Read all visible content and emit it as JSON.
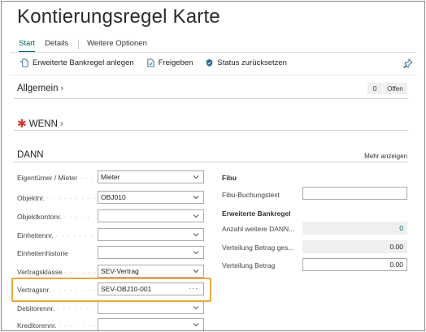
{
  "page": {
    "title": "Kontierungsregel Karte"
  },
  "tabs": [
    {
      "label": "Start",
      "active": true
    },
    {
      "label": "Details",
      "active": false
    },
    {
      "label": "Weitere Optionen",
      "active": false
    }
  ],
  "actions": {
    "create_bank_rule": "Erweiterte Bankregel anlegen",
    "release": "Freigeben",
    "reset_status": "Status zurücksetzen"
  },
  "sections": {
    "allgemein": {
      "title": "Allgemein",
      "count": "0",
      "status": "Offen"
    },
    "wenn": {
      "title": "WENN"
    },
    "dann": {
      "title": "DANN",
      "show_more": "Mehr anzeigen"
    }
  },
  "left_fields": [
    {
      "label": "Eigentümer / Mieter",
      "value": "Mieter",
      "control": "select"
    },
    {
      "label": "Objektnr.",
      "value": "OBJ010",
      "control": "select"
    },
    {
      "label": "Objektkontonr.",
      "value": "",
      "control": "select"
    },
    {
      "label": "Einheitennr.",
      "value": "",
      "control": "select"
    },
    {
      "label": "Einheitenhistorie",
      "value": "",
      "control": "select"
    },
    {
      "label": "Vertragsklasse",
      "value": "SEV-Vertrag",
      "control": "select"
    },
    {
      "label": "Vertragsnr.",
      "value": "SEV-OBJ10-001",
      "control": "lookup"
    },
    {
      "label": "Debitorennr.",
      "value": "",
      "control": "select"
    },
    {
      "label": "Kreditorennr.",
      "value": "",
      "control": "select"
    }
  ],
  "right": {
    "fibu_heading": "Fibu",
    "fibu_posting_text_label": "Fibu-Buchungstext",
    "fibu_posting_text_value": "",
    "bank_rule_heading": "Erweiterte Bankregel",
    "count_more_label": "Anzahl weitere DANN...",
    "count_more_value": "0",
    "dist_amount_remaining_label": "Verteilung Betrag ges...",
    "dist_amount_remaining_value": "0.00",
    "dist_amount_label": "Verteilung Betrag",
    "dist_amount_value": "0.00"
  },
  "colors": {
    "accent": "#00625f",
    "highlight": "#e8a93a",
    "required": "#d33a2f"
  },
  "icons": [
    "new-document-icon",
    "release-icon",
    "reset-status-icon",
    "pin-icon",
    "chevron-right-icon",
    "chevron-down-icon",
    "ellipsis-icon",
    "required-star-icon"
  ]
}
